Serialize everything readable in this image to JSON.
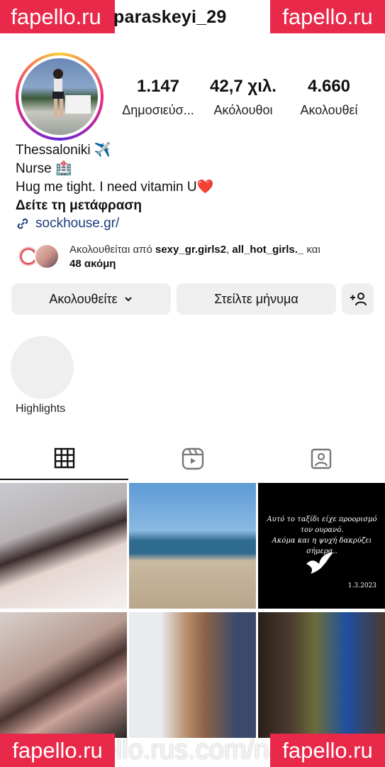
{
  "header": {
    "username": "paraskeyi_29",
    "watermark_left": "fapello.ru",
    "watermark_right": "fapello.ru"
  },
  "stats": [
    {
      "value": "1.147",
      "label": "Δημοσιεύσ..."
    },
    {
      "value": "42,7 χιλ.",
      "label": "Ακόλουθοι"
    },
    {
      "value": "4.660",
      "label": "Ακολουθεί"
    }
  ],
  "bio": {
    "line1": "Thessaloniki ✈️",
    "line2": "Nurse 🏥",
    "line3": "Hug me tight. I need vitamin U❤️",
    "translate": "Δείτε τη μετάφραση",
    "link": "sockhouse.gr/"
  },
  "followed_by": {
    "prefix": "Ακολουθείται από ",
    "user1": "sexy_gr.girls2",
    "sep": ", ",
    "user2": "all_hot_girls._",
    "and": " και",
    "more": "48 ακόμη"
  },
  "buttons": {
    "following": "Ακολουθείτε",
    "message": "Στείλτε μήνυμα"
  },
  "highlights": {
    "label": "Highlights"
  },
  "tabs": {
    "icons": [
      "grid-icon",
      "reels-icon",
      "tagged-icon"
    ]
  },
  "posts": {
    "quote": "Αυτό το ταξίδι είχε προορισμό τον ουρανό.\nΑκόμα και η ψυχή δακρύζει σήμερα..",
    "date": "1.3.2023"
  },
  "footer_watermark": {
    "url": "fapello.rus.com/name",
    "left": "fapello.ru",
    "right": "fapello.ru"
  },
  "colors": {
    "watermark": "#e8294a",
    "link": "#1b3d7a",
    "button_bg": "#efefef"
  }
}
